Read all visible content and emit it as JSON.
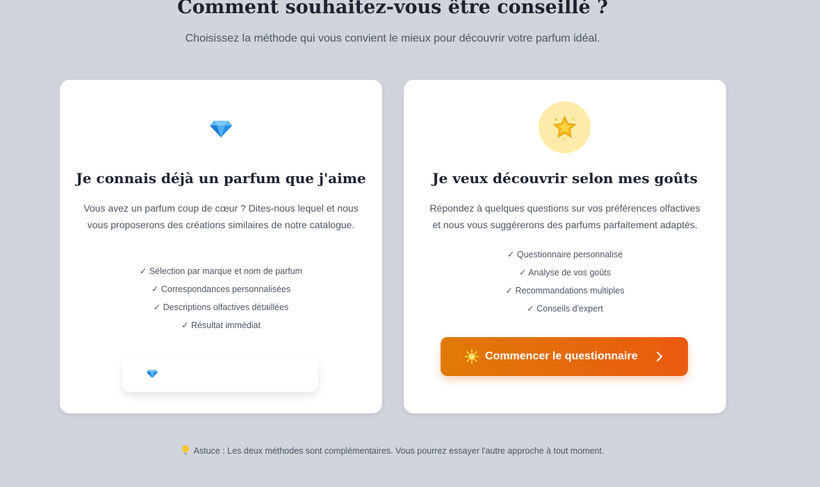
{
  "header": {
    "title": "Comment souhaitez-vous être conseillé ?",
    "subtitle": "Choisissez la méthode qui vous convient le mieux pour découvrir votre parfum idéal."
  },
  "cards": [
    {
      "icon": "gem-icon",
      "title": "Je connais déjà un parfum que j'aime",
      "description": "Vous avez un parfum coup de cœur ? Dites-nous lequel et nous vous proposerons des créations similaires de notre catalogue.",
      "features": [
        "✓ Sélection par marque et nom de parfum",
        "✓ Correspondances personnalisées",
        "✓ Descriptions olfactives détaillées",
        "✓ Résultat immédiat"
      ],
      "select_icon": "gem-icon"
    },
    {
      "icon": "star-icon",
      "title": "Je veux découvrir selon mes goûts",
      "description": "Répondez à quelques questions sur vos préférences olfactives et nous vous suggérerons des parfums parfaitement adaptés.",
      "features": [
        "✓ Questionnaire personnalisé",
        "✓ Analyse de vos goûts",
        "✓ Recommandations multiples",
        "✓ Conseils d'expert"
      ],
      "button": {
        "label": "Commencer le questionnaire",
        "icon": "sun-icon",
        "trailing_icon": "chevron-right-icon"
      }
    }
  ],
  "tip": {
    "icon": "light-bulb-icon",
    "text": "Astuce : Les deux méthodes sont complémentaires. Vous pourrez essayer l'autre approche à tout moment."
  },
  "colors": {
    "background": "#d1d4db",
    "card": "#ffffff",
    "button_gradient_start": "#e07a06",
    "button_gradient_end": "#ea5a10",
    "star_circle": "#fdeca9"
  }
}
